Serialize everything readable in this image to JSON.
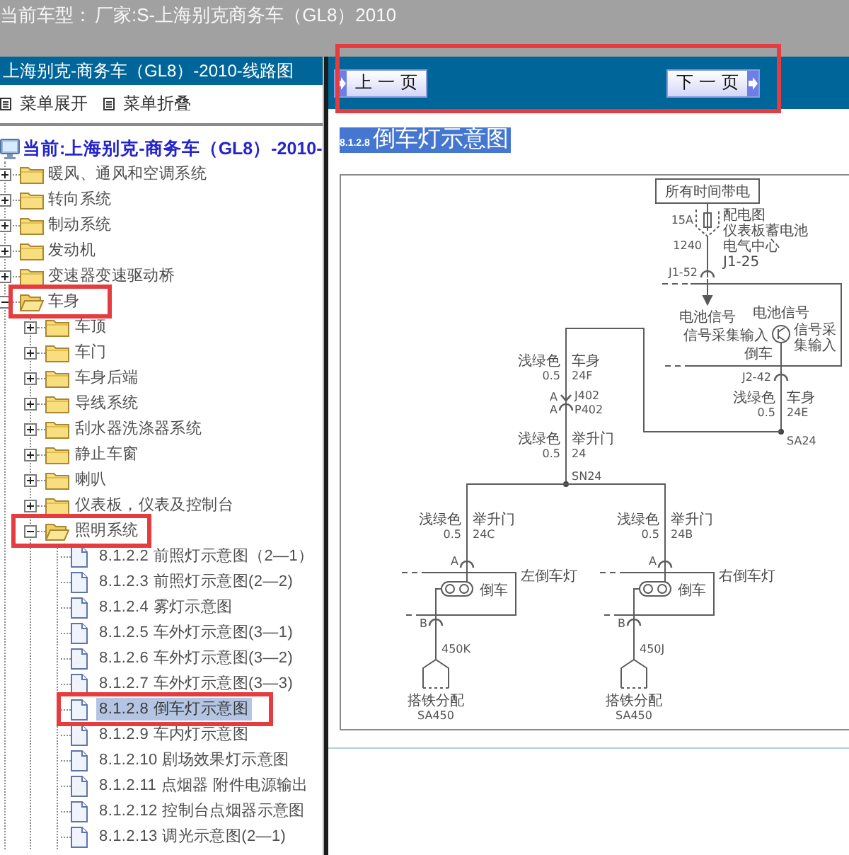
{
  "header": {
    "label": "当前车型：",
    "value": "厂家:S-上海别克商务车（GL8）2010"
  },
  "sidebar": {
    "title": "上海别克-商务车（GL8）-2010-线路图",
    "toolbar": [
      {
        "label": "菜单展开"
      },
      {
        "label": "菜单折叠"
      }
    ],
    "tree": {
      "root": "当前:上海别克-商务车（GL8）-2010-",
      "items": [
        {
          "label": "暖风、通风和空调系统",
          "expanded": false,
          "highlighted": false
        },
        {
          "label": "转向系统",
          "expanded": false,
          "highlighted": false
        },
        {
          "label": "制动系统",
          "expanded": false,
          "highlighted": false
        },
        {
          "label": "发动机",
          "expanded": false,
          "highlighted": false
        },
        {
          "label": "变速器变速驱动桥",
          "expanded": false,
          "highlighted": false
        },
        {
          "label": "车身",
          "expanded": true,
          "highlighted": true,
          "children": [
            {
              "label": "车顶",
              "expanded": false,
              "highlighted": false
            },
            {
              "label": "车门",
              "expanded": false,
              "highlighted": false
            },
            {
              "label": "车身后端",
              "expanded": false,
              "highlighted": false
            },
            {
              "label": "导线系统",
              "expanded": false,
              "highlighted": false
            },
            {
              "label": "刮水器洗涤器系统",
              "expanded": false,
              "highlighted": false
            },
            {
              "label": "静止车窗",
              "expanded": false,
              "highlighted": false
            },
            {
              "label": "喇叭",
              "expanded": false,
              "highlighted": false
            },
            {
              "label": "仪表板，仪表及控制台",
              "expanded": false,
              "highlighted": false
            },
            {
              "label": "照明系统",
              "expanded": true,
              "highlighted": true,
              "children": [
                {
                  "label": "8.1.2.2 前照灯示意图（2—1）",
                  "selected": false,
                  "highlighted": false
                },
                {
                  "label": "8.1.2.3 前照灯示意图(2—2)",
                  "selected": false,
                  "highlighted": false
                },
                {
                  "label": "8.1.2.4 雾灯示意图",
                  "selected": false,
                  "highlighted": false
                },
                {
                  "label": "8.1.2.5 车外灯示意图(3—1)",
                  "selected": false,
                  "highlighted": false
                },
                {
                  "label": "8.1.2.6 车外灯示意图(3—2)",
                  "selected": false,
                  "highlighted": false
                },
                {
                  "label": "8.1.2.7 车外灯示意图(3—3)",
                  "selected": false,
                  "highlighted": false
                },
                {
                  "label": "8.1.2.8 倒车灯示意图",
                  "selected": true,
                  "highlighted": true
                },
                {
                  "label": "8.1.2.9 车内灯示意图",
                  "selected": false,
                  "highlighted": false
                },
                {
                  "label": "8.1.2.10 剧场效果灯示意图",
                  "selected": false,
                  "highlighted": false
                },
                {
                  "label": "8.1.2.11 点烟器 附件电源输出",
                  "selected": false,
                  "highlighted": false
                },
                {
                  "label": "8.1.2.12 控制台点烟器示意图",
                  "selected": false,
                  "highlighted": false
                },
                {
                  "label": "8.1.2.13 调光示意图(2—1)",
                  "selected": false,
                  "highlighted": false
                }
              ]
            }
          ]
        }
      ]
    }
  },
  "nav": {
    "highlighted": true,
    "buttons": [
      {
        "kind": "prev",
        "label": "上一页"
      },
      {
        "kind": "next",
        "label": "下一页"
      }
    ]
  },
  "document": {
    "title": {
      "number": "8.1.2.8",
      "text": "倒车灯示意图",
      "highlighted": true
    },
    "diagram": {
      "power_source": "所有时间带电",
      "fuse_rating": "15A",
      "fuse_number": "1240",
      "fuse_location": [
        "配电图",
        "仪表板蓄电池",
        "电气中心",
        "J1-25"
      ],
      "feed_connector": "J1-52",
      "module": {
        "input_signal": "电池信号",
        "output_signal": "电池信号",
        "left_label": "信号采集输入",
        "right_label": [
          "信号采",
          "集输入"
        ],
        "function": "倒车",
        "connector": "J2-42"
      },
      "feed_wire": {
        "wire_color": "浅绿色",
        "gauge": "0.5",
        "harness": "车身",
        "circuit": "24E",
        "splice": "SA24"
      },
      "body_wire": {
        "wire_color": "浅绿色",
        "gauge": "0.5",
        "harness": "车身",
        "circuit": "24F"
      },
      "inline_connector": {
        "pin_upper": "A",
        "name_upper": "J402",
        "pin_lower": "A",
        "name_lower": "P402"
      },
      "liftgate_wire": {
        "wire_color": "浅绿色",
        "gauge": "0.5",
        "harness": "举升门",
        "circuit": "24",
        "splice": "SN24"
      },
      "lamps": [
        {
          "wire_color": "浅绿色",
          "wire_gauge": "0.5",
          "harness": "举升门",
          "circuit": "24C",
          "pin_in": "A",
          "name": "左倒车灯",
          "function": "倒车",
          "pin_out": "B",
          "ground_circuit": "450K",
          "ground": "搭铁分配",
          "ground_splice": "SA450"
        },
        {
          "wire_color": "浅绿色",
          "wire_gauge": "0.5",
          "harness": "举升门",
          "circuit": "24B",
          "pin_in": "A",
          "name": "右倒车灯",
          "function": "倒车",
          "pin_out": "B",
          "ground_circuit": "450J",
          "ground": "搭铁分配",
          "ground_splice": "SA450"
        }
      ]
    }
  }
}
